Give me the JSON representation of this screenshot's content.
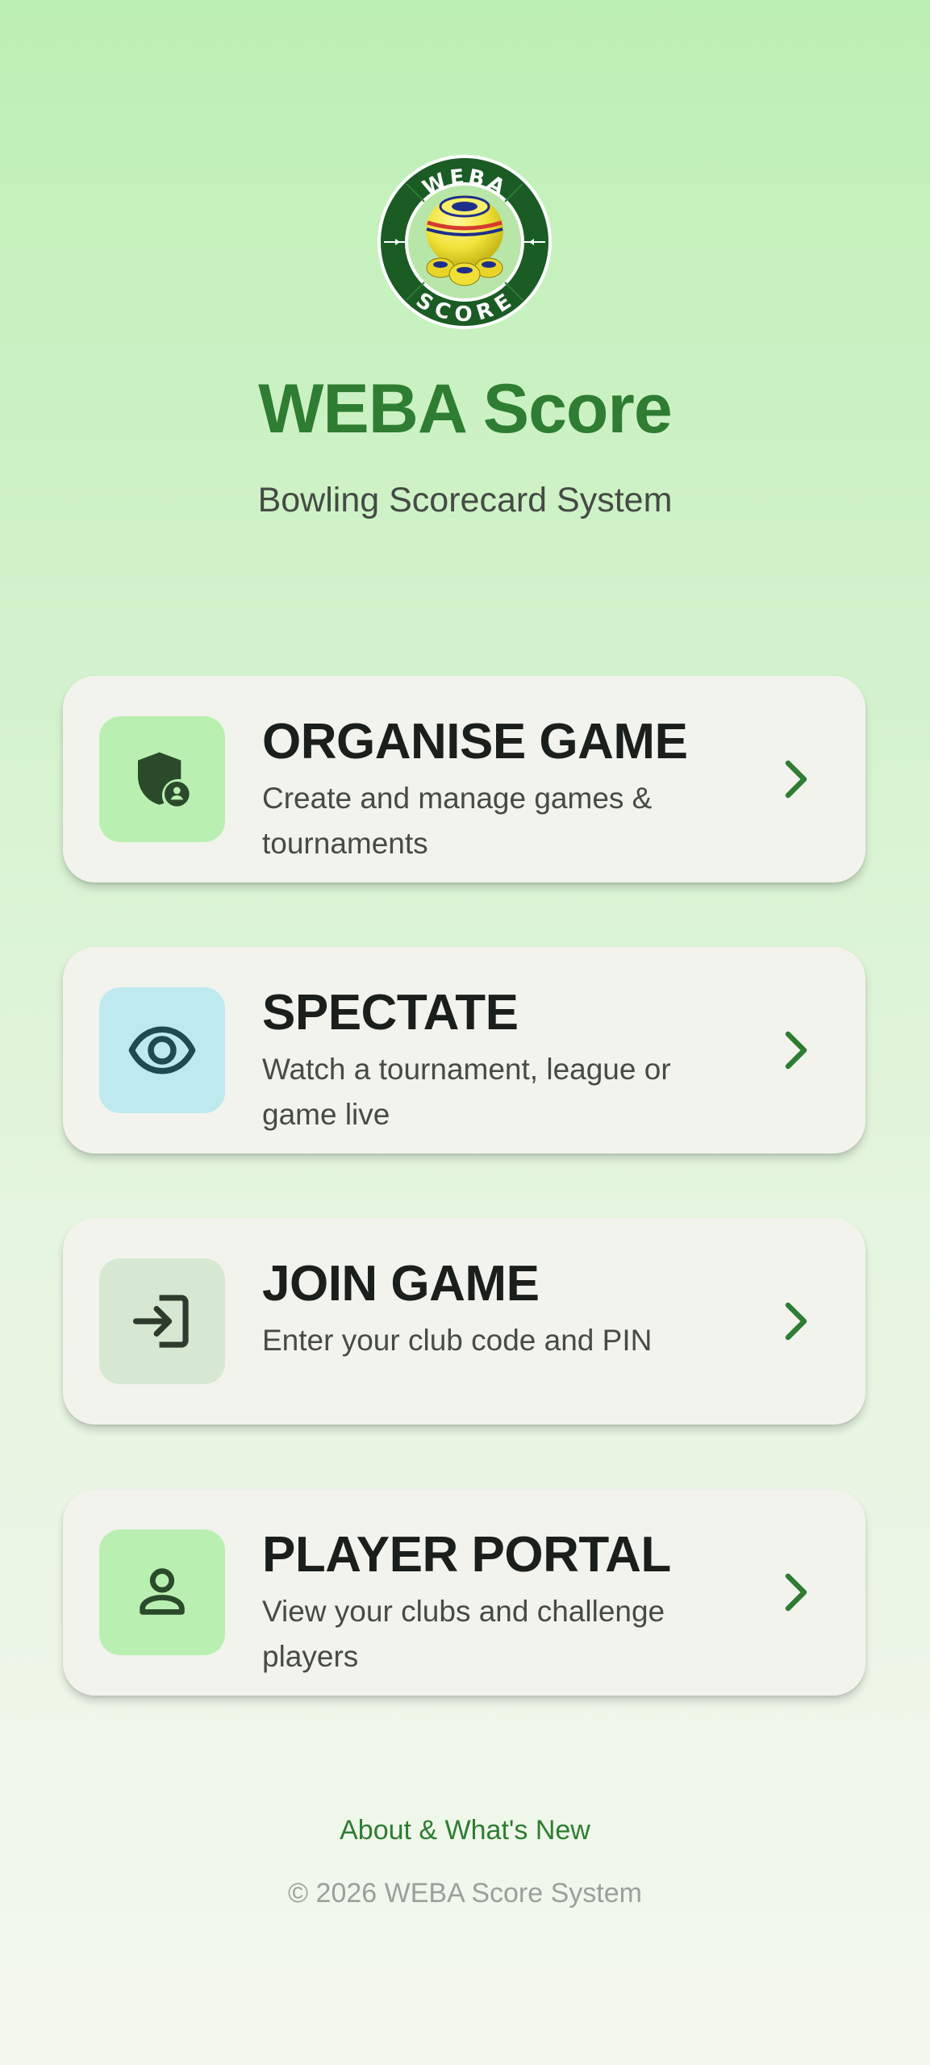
{
  "header": {
    "logo_icon": "weba-score-bowls-logo-icon",
    "logo_top_text": "WEBA",
    "logo_bottom_text": "SCORE",
    "title": "WEBA Score",
    "subtitle": "Bowling Scorecard System"
  },
  "menu": [
    {
      "title": "ORGANISE GAME",
      "description": "Create and manage games & tournaments",
      "icon": "shield-person-icon",
      "icon_bg": "#b9f0b1"
    },
    {
      "title": "SPECTATE",
      "description": "Watch a tournament, league or game live",
      "icon": "eye-icon",
      "icon_bg": "#bde9ef"
    },
    {
      "title": "JOIN GAME",
      "description": "Enter your club code and PIN",
      "icon": "login-arrow-icon",
      "icon_bg": "#d6e8d2"
    },
    {
      "title": "PLAYER PORTAL",
      "description": "View your clubs and challenge players",
      "icon": "person-icon",
      "icon_bg": "#b9f0b1"
    }
  ],
  "footer": {
    "about_link": "About & What's New",
    "copyright": "© 2026 WEBA Score System"
  },
  "colors": {
    "accent": "#2e7d32",
    "card_bg": "#f2f3ed",
    "title_text": "#1b1f1b"
  }
}
